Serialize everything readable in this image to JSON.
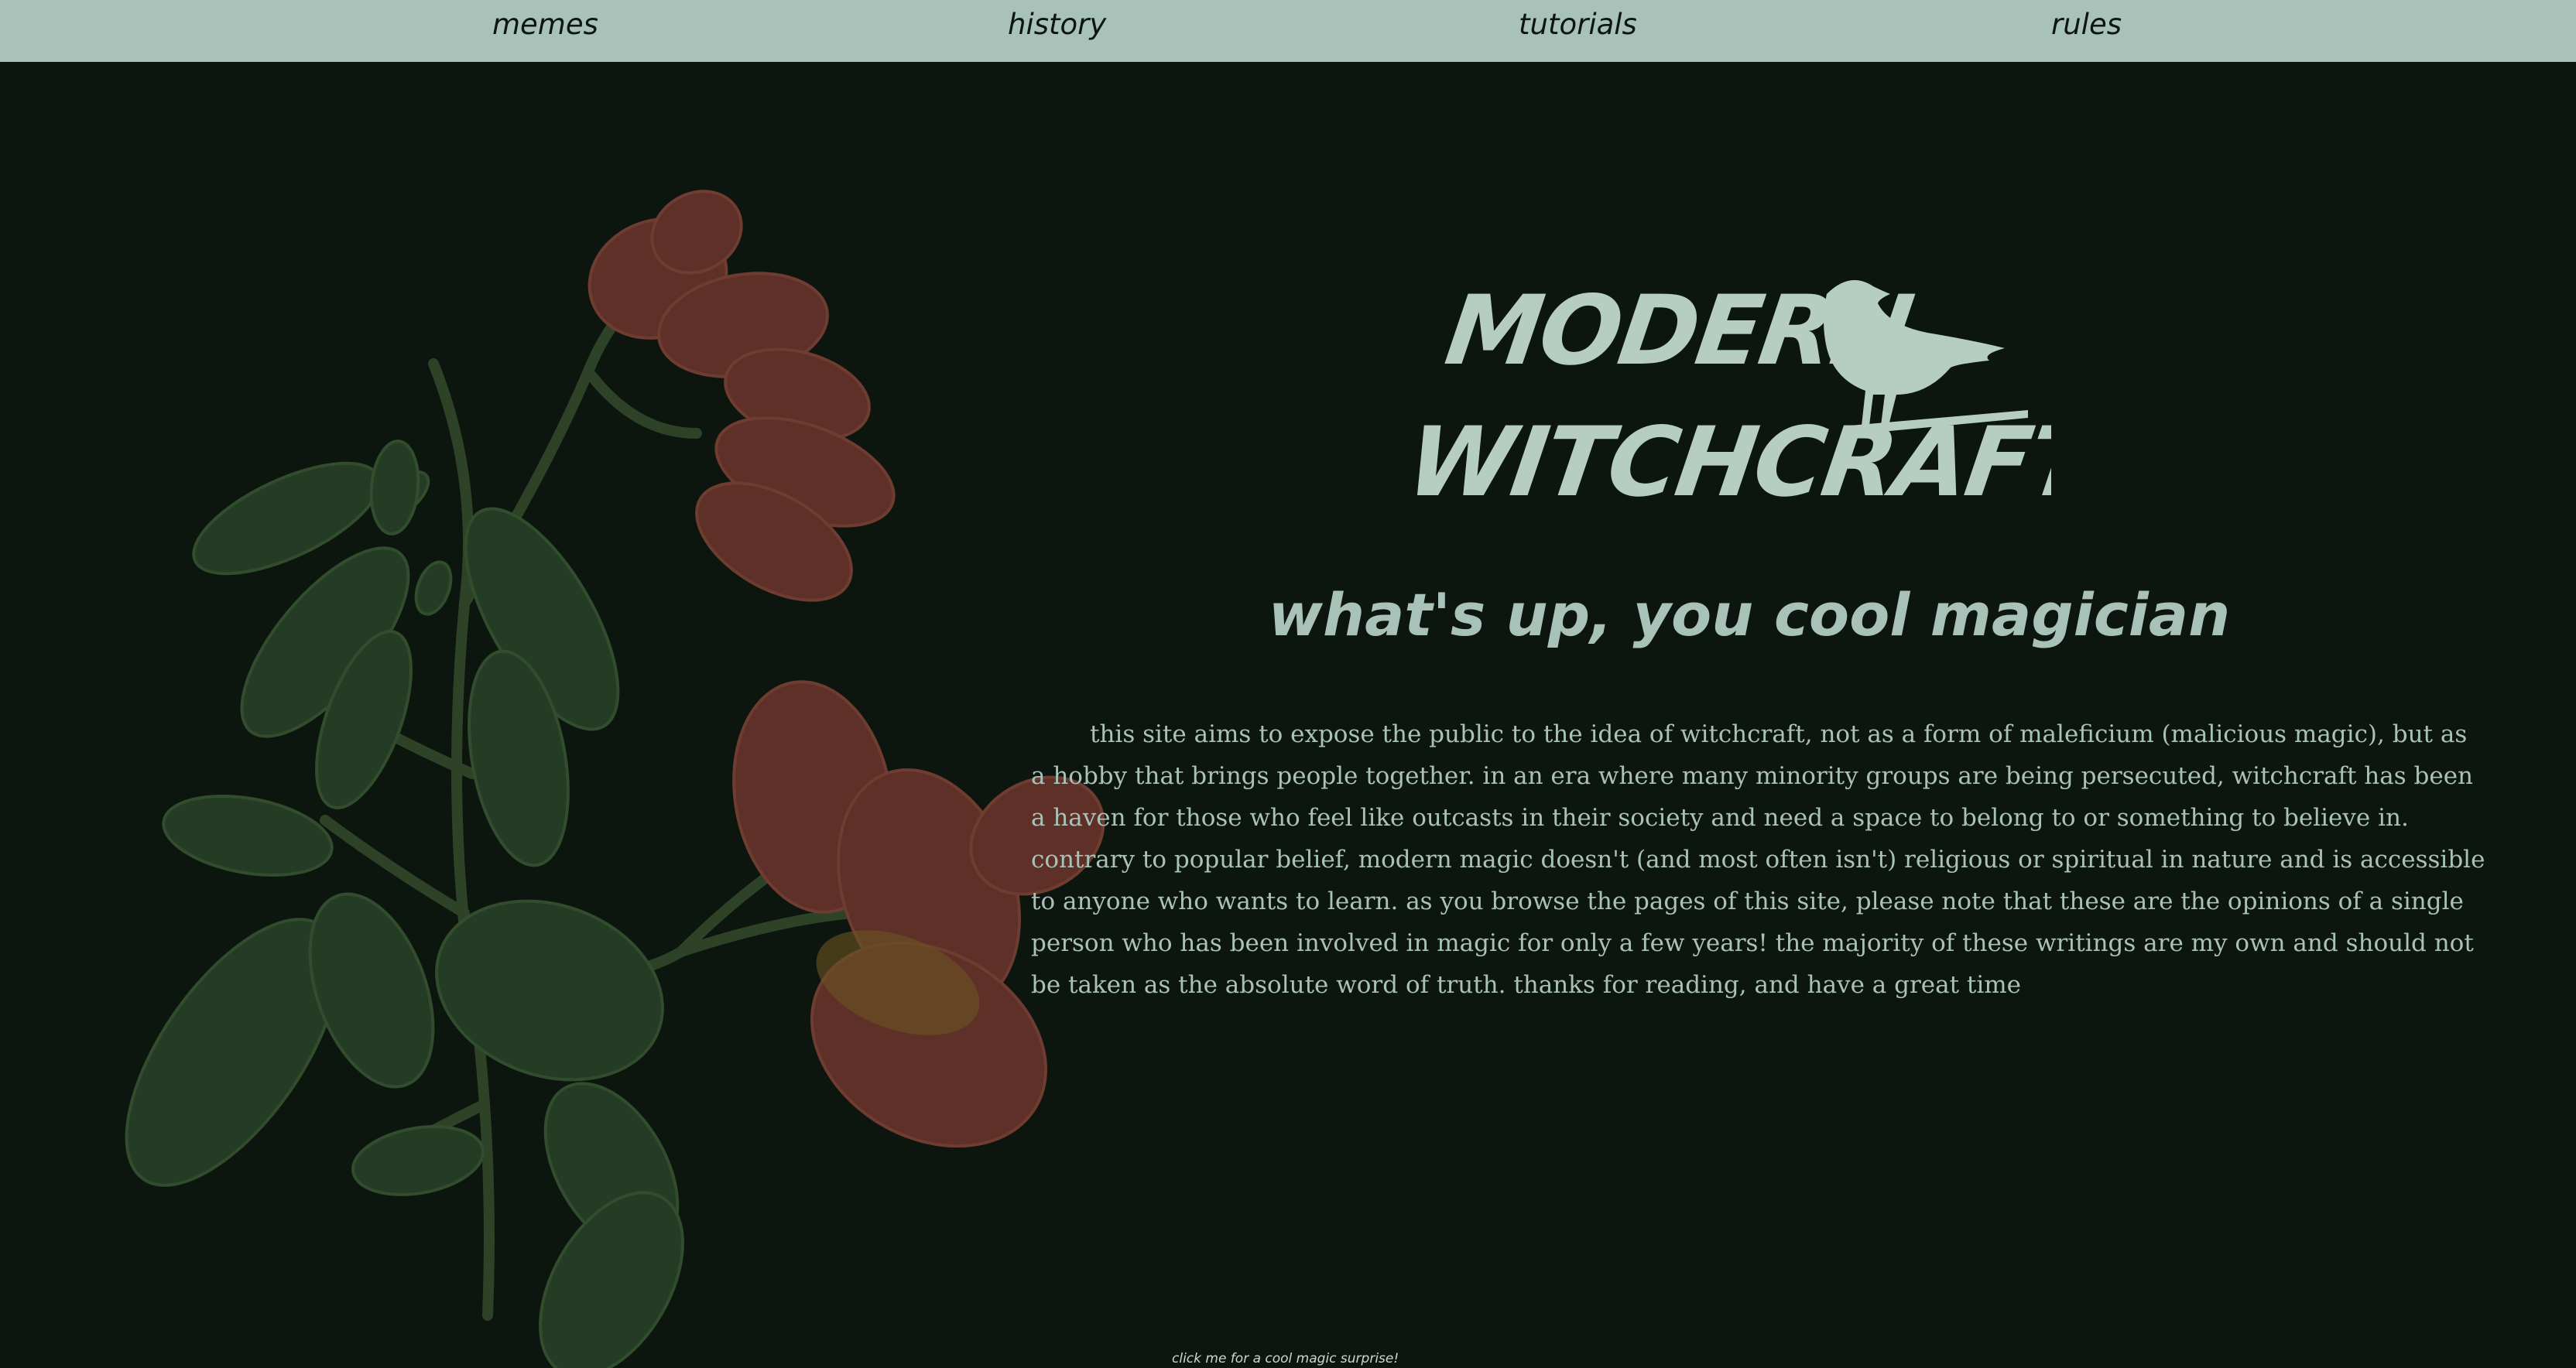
{
  "nav": {
    "items": [
      {
        "label": "memes"
      },
      {
        "label": "history"
      },
      {
        "label": "tutorials"
      },
      {
        "label": "rules"
      }
    ]
  },
  "logo": {
    "line1": "MODERN",
    "line2": "WITCHCRAFT",
    "icon": "crow-icon"
  },
  "hero": {
    "greeting": "what's up, you cool magician",
    "intro": "this site aims to expose the public to the idea of witchcraft, not as a form of maleficium (malicious magic), but as a hobby that brings people together. in an era where many minority groups are being persecuted, witchcraft has been a haven for those who feel like outcasts in their society and need a space to belong to or something to believe in. contrary to popular belief, modern magic doesn't (and most often isn't) religious or spiritual in nature and is accessible to anyone who wants to learn. as you browse the pages of this site, please note that these are the opinions of a single person who has been involved in magic for only a few years! the majority of these writings are my own and should not be taken as the absolute word of truth. thanks for reading, and have a great time"
  },
  "footer": {
    "surprise_link": "click me for a cool magic surprise!"
  },
  "colors": {
    "background": "#0d160e",
    "navbar": "#a9c2b9",
    "text": "#a9c2b9",
    "leaf_green": "#2c4a2b",
    "leaf_red": "#7a3a30"
  }
}
